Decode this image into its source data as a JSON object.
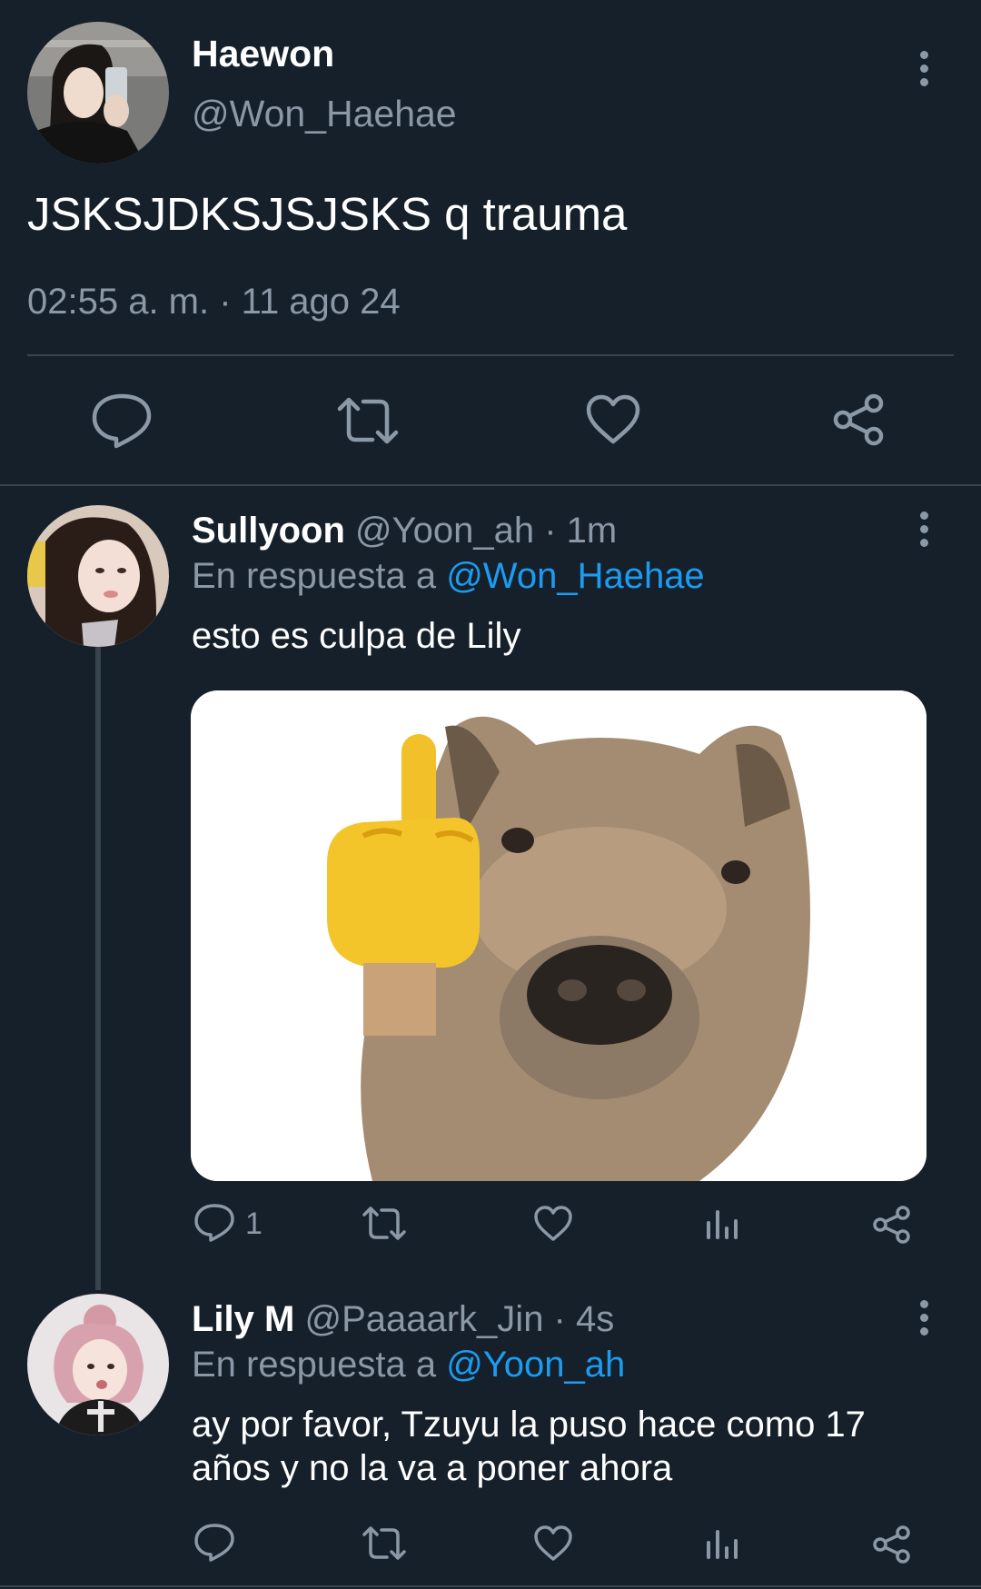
{
  "main_tweet": {
    "name": "Haewon",
    "handle": "@Won_Haehae",
    "text": "JSKSJDKSJSJSKS q trauma",
    "timestamp": "02:55 a. m. · 11 ago 24",
    "actions": [
      "reply-icon",
      "retweet-icon",
      "like-icon",
      "share-icon"
    ]
  },
  "replies": [
    {
      "name": "Sullyoon",
      "meta": "@Yoon_ah · 1m",
      "reply_prefix": "En respuesta a",
      "reply_to": "@Won_Haehae",
      "text": "esto es culpa de Lily",
      "reply_count": "1",
      "has_media": true
    },
    {
      "name": "Lily M",
      "meta": "@Paaaark_Jin · 4s",
      "reply_prefix": "En respuesta a",
      "reply_to": "@Yoon_ah",
      "text": "ay por favor, Tzuyu la puso hace como 17 años y no la va a poner ahora",
      "reply_count": ""
    }
  ],
  "colors": {
    "background": "#15202b",
    "secondary_text": "#8b98a5",
    "link": "#1d9bf0",
    "divider": "#38444d"
  }
}
